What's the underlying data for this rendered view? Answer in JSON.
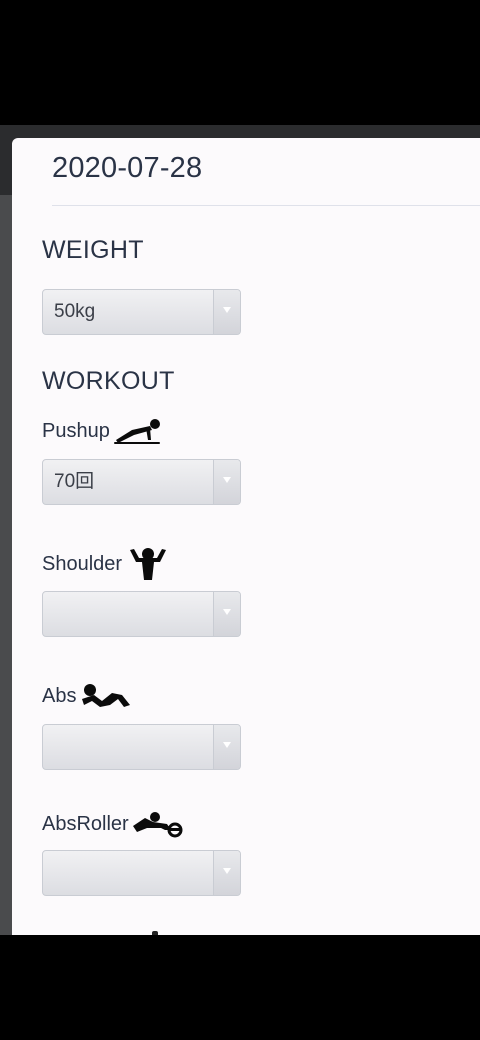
{
  "header": {
    "date": "2020-07-28"
  },
  "weight": {
    "title": "WEIGHT",
    "selected": "50kg"
  },
  "workout": {
    "title": "WORKOUT",
    "items": [
      {
        "label": "Pushup",
        "icon": "pushup-icon",
        "selected": "70回"
      },
      {
        "label": "Shoulder",
        "icon": "shoulder-icon",
        "selected": ""
      },
      {
        "label": "Abs",
        "icon": "abs-icon",
        "selected": ""
      },
      {
        "label": "AbsRoller",
        "icon": "absroller-icon",
        "selected": ""
      }
    ]
  },
  "colors": {
    "text": "#2a3346",
    "sheet": "#fcfafc",
    "select_border": "#c9ccd3"
  }
}
